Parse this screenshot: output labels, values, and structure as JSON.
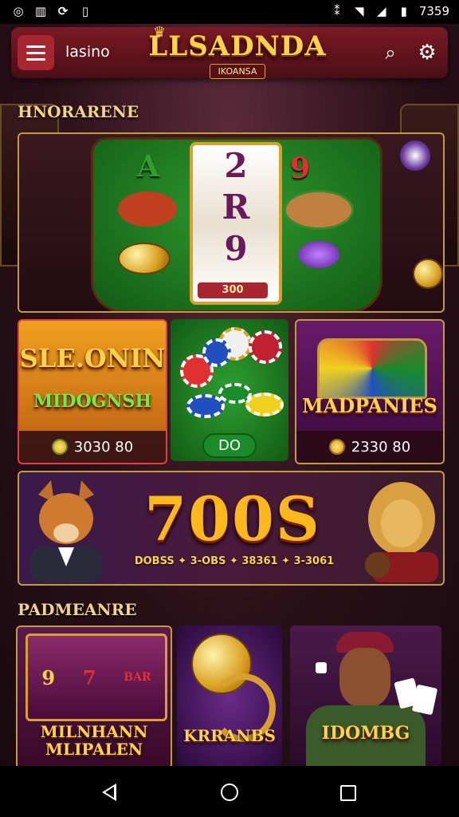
{
  "status_bar": {
    "left_icons": [
      "notification-icon",
      "chart-icon",
      "sync-icon",
      "battery-saver-icon"
    ],
    "time": "7359"
  },
  "header": {
    "app_name": "lasino",
    "logo_text": "LLSADNDA",
    "logo_subtext": "IKOANSA"
  },
  "sections": {
    "featured_title": "HNORARENE",
    "popular_title": "PADMEANRE"
  },
  "hero": {
    "reel_symbols": [
      "2",
      "R",
      "9"
    ],
    "reel_badge": "300",
    "left_symbol": "A",
    "right_symbol": "9"
  },
  "tiles": [
    {
      "title": "SLE.ONIN",
      "subtitle": "MIDOGNSH",
      "footer": "3030 80"
    },
    {
      "title": "",
      "subtitle": "",
      "footer": "DO"
    },
    {
      "title": "MADPANIES",
      "subtitle": "",
      "footer": "2330 80"
    }
  ],
  "banner": {
    "big_text": "700S",
    "ticker": "DOBSS ✦ 3-OBS ✦ 38361 ✦ 3-3061"
  },
  "cards": [
    {
      "title": "MILNHANN MLIPALEN",
      "slot_labels": [
        "9",
        "7",
        "BAR"
      ]
    },
    {
      "title": "KRRANBS"
    },
    {
      "title": "IDOMBG"
    }
  ],
  "colors": {
    "accent": "#ffd24a",
    "header_bg": "#7a1a24",
    "frame_gold": "#c49a40",
    "felt_green": "#2e9a2e"
  }
}
